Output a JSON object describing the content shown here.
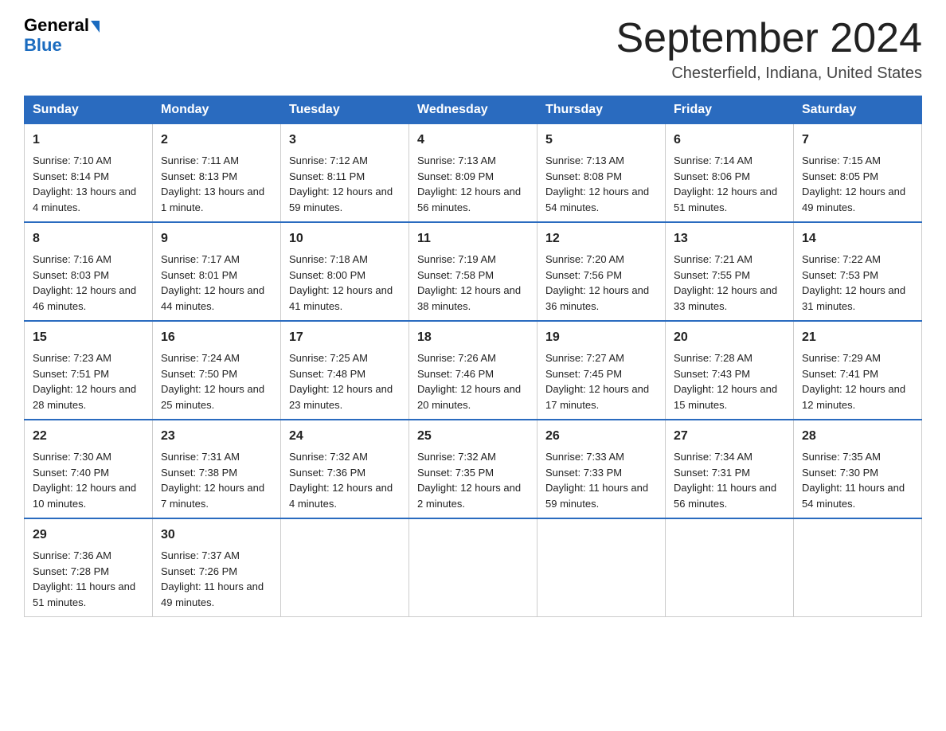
{
  "header": {
    "logo_line1": "General",
    "logo_line2": "Blue",
    "month_title": "September 2024",
    "location": "Chesterfield, Indiana, United States"
  },
  "days_of_week": [
    "Sunday",
    "Monday",
    "Tuesday",
    "Wednesday",
    "Thursday",
    "Friday",
    "Saturday"
  ],
  "weeks": [
    [
      {
        "day": "1",
        "sunrise": "7:10 AM",
        "sunset": "8:14 PM",
        "daylight": "13 hours and 4 minutes."
      },
      {
        "day": "2",
        "sunrise": "7:11 AM",
        "sunset": "8:13 PM",
        "daylight": "13 hours and 1 minute."
      },
      {
        "day": "3",
        "sunrise": "7:12 AM",
        "sunset": "8:11 PM",
        "daylight": "12 hours and 59 minutes."
      },
      {
        "day": "4",
        "sunrise": "7:13 AM",
        "sunset": "8:09 PM",
        "daylight": "12 hours and 56 minutes."
      },
      {
        "day": "5",
        "sunrise": "7:13 AM",
        "sunset": "8:08 PM",
        "daylight": "12 hours and 54 minutes."
      },
      {
        "day": "6",
        "sunrise": "7:14 AM",
        "sunset": "8:06 PM",
        "daylight": "12 hours and 51 minutes."
      },
      {
        "day": "7",
        "sunrise": "7:15 AM",
        "sunset": "8:05 PM",
        "daylight": "12 hours and 49 minutes."
      }
    ],
    [
      {
        "day": "8",
        "sunrise": "7:16 AM",
        "sunset": "8:03 PM",
        "daylight": "12 hours and 46 minutes."
      },
      {
        "day": "9",
        "sunrise": "7:17 AM",
        "sunset": "8:01 PM",
        "daylight": "12 hours and 44 minutes."
      },
      {
        "day": "10",
        "sunrise": "7:18 AM",
        "sunset": "8:00 PM",
        "daylight": "12 hours and 41 minutes."
      },
      {
        "day": "11",
        "sunrise": "7:19 AM",
        "sunset": "7:58 PM",
        "daylight": "12 hours and 38 minutes."
      },
      {
        "day": "12",
        "sunrise": "7:20 AM",
        "sunset": "7:56 PM",
        "daylight": "12 hours and 36 minutes."
      },
      {
        "day": "13",
        "sunrise": "7:21 AM",
        "sunset": "7:55 PM",
        "daylight": "12 hours and 33 minutes."
      },
      {
        "day": "14",
        "sunrise": "7:22 AM",
        "sunset": "7:53 PM",
        "daylight": "12 hours and 31 minutes."
      }
    ],
    [
      {
        "day": "15",
        "sunrise": "7:23 AM",
        "sunset": "7:51 PM",
        "daylight": "12 hours and 28 minutes."
      },
      {
        "day": "16",
        "sunrise": "7:24 AM",
        "sunset": "7:50 PM",
        "daylight": "12 hours and 25 minutes."
      },
      {
        "day": "17",
        "sunrise": "7:25 AM",
        "sunset": "7:48 PM",
        "daylight": "12 hours and 23 minutes."
      },
      {
        "day": "18",
        "sunrise": "7:26 AM",
        "sunset": "7:46 PM",
        "daylight": "12 hours and 20 minutes."
      },
      {
        "day": "19",
        "sunrise": "7:27 AM",
        "sunset": "7:45 PM",
        "daylight": "12 hours and 17 minutes."
      },
      {
        "day": "20",
        "sunrise": "7:28 AM",
        "sunset": "7:43 PM",
        "daylight": "12 hours and 15 minutes."
      },
      {
        "day": "21",
        "sunrise": "7:29 AM",
        "sunset": "7:41 PM",
        "daylight": "12 hours and 12 minutes."
      }
    ],
    [
      {
        "day": "22",
        "sunrise": "7:30 AM",
        "sunset": "7:40 PM",
        "daylight": "12 hours and 10 minutes."
      },
      {
        "day": "23",
        "sunrise": "7:31 AM",
        "sunset": "7:38 PM",
        "daylight": "12 hours and 7 minutes."
      },
      {
        "day": "24",
        "sunrise": "7:32 AM",
        "sunset": "7:36 PM",
        "daylight": "12 hours and 4 minutes."
      },
      {
        "day": "25",
        "sunrise": "7:32 AM",
        "sunset": "7:35 PM",
        "daylight": "12 hours and 2 minutes."
      },
      {
        "day": "26",
        "sunrise": "7:33 AM",
        "sunset": "7:33 PM",
        "daylight": "11 hours and 59 minutes."
      },
      {
        "day": "27",
        "sunrise": "7:34 AM",
        "sunset": "7:31 PM",
        "daylight": "11 hours and 56 minutes."
      },
      {
        "day": "28",
        "sunrise": "7:35 AM",
        "sunset": "7:30 PM",
        "daylight": "11 hours and 54 minutes."
      }
    ],
    [
      {
        "day": "29",
        "sunrise": "7:36 AM",
        "sunset": "7:28 PM",
        "daylight": "11 hours and 51 minutes."
      },
      {
        "day": "30",
        "sunrise": "7:37 AM",
        "sunset": "7:26 PM",
        "daylight": "11 hours and 49 minutes."
      },
      {
        "day": "",
        "sunrise": "",
        "sunset": "",
        "daylight": ""
      },
      {
        "day": "",
        "sunrise": "",
        "sunset": "",
        "daylight": ""
      },
      {
        "day": "",
        "sunrise": "",
        "sunset": "",
        "daylight": ""
      },
      {
        "day": "",
        "sunrise": "",
        "sunset": "",
        "daylight": ""
      },
      {
        "day": "",
        "sunrise": "",
        "sunset": "",
        "daylight": ""
      }
    ]
  ],
  "labels": {
    "sunrise_prefix": "Sunrise: ",
    "sunset_prefix": "Sunset: ",
    "daylight_prefix": "Daylight: "
  }
}
